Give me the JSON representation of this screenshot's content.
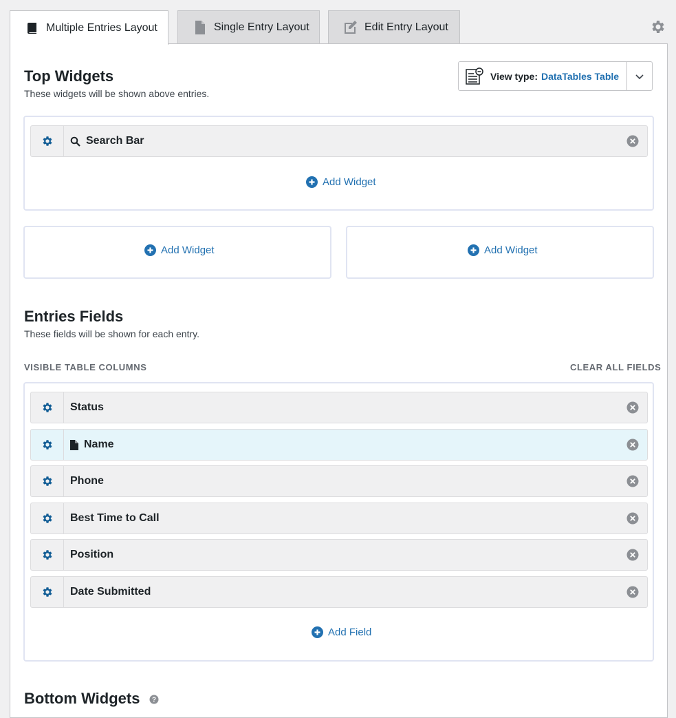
{
  "tabs": [
    {
      "label": "Multiple Entries Layout",
      "icon": "book-icon",
      "active": true
    },
    {
      "label": "Single Entry Layout",
      "icon": "document-icon",
      "active": false
    },
    {
      "label": "Edit Entry Layout",
      "icon": "edit-icon",
      "active": false
    }
  ],
  "top_widgets": {
    "title": "Top Widgets",
    "description": "These widgets will be shown above entries.",
    "view_type": {
      "label": "View type:",
      "value": "DataTables Table"
    },
    "items": [
      {
        "label": "Search Bar",
        "icon": "search-icon"
      }
    ],
    "add_label": "Add Widget",
    "left_add_label": "Add Widget",
    "right_add_label": "Add Widget"
  },
  "entries_fields": {
    "title": "Entries Fields",
    "description": "These fields will be shown for each entry.",
    "columns_header": "VISIBLE TABLE COLUMNS",
    "clear_all": "CLEAR ALL FIELDS",
    "fields": [
      {
        "label": "Status"
      },
      {
        "label": "Name",
        "icon": "document-icon",
        "highlighted": true
      },
      {
        "label": "Phone"
      },
      {
        "label": "Best Time to Call"
      },
      {
        "label": "Position"
      },
      {
        "label": "Date Submitted"
      }
    ],
    "add_label": "Add Field"
  },
  "bottom_widgets": {
    "title": "Bottom Widgets"
  },
  "colors": {
    "accent": "#2271b1",
    "gear": "#135e96",
    "remove": "#8c8f94"
  }
}
